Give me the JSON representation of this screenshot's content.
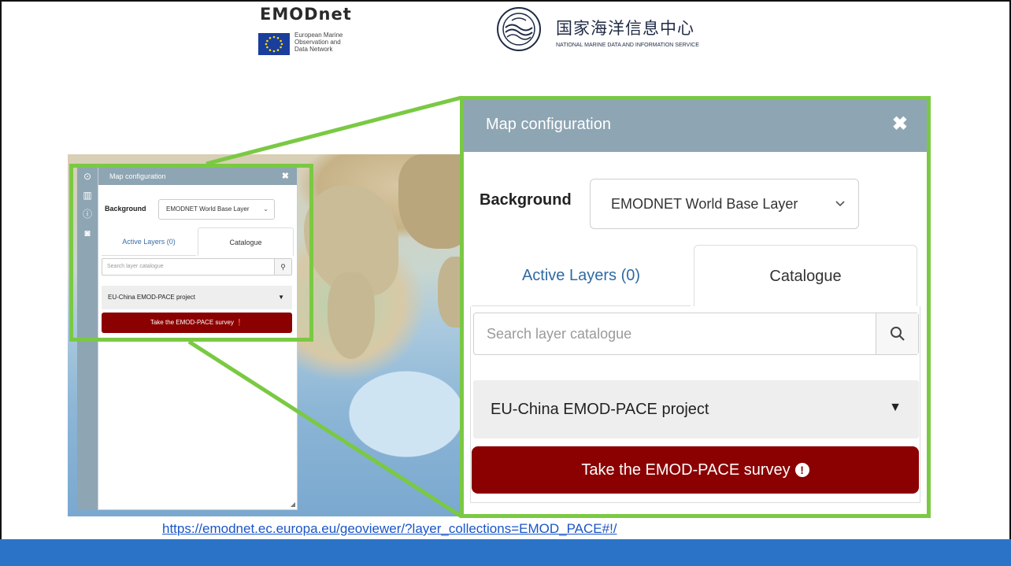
{
  "logos": {
    "emodnet_word": "EMODnet",
    "emodnet_subtitle": "European Marine\nObservation and\nData Network",
    "nmdis_cn": "国家海洋信息中心",
    "nmdis_en": "NATIONAL MARINE DATA AND INFORMATION SERVICE"
  },
  "sidebar_icons": [
    "target-icon",
    "map-icon",
    "info-icon",
    "camera-icon"
  ],
  "panel": {
    "title": "Map configuration",
    "close_glyph": "✖",
    "background_label": "Background",
    "background_value": "EMODNET World Base Layer",
    "caret": "⌄",
    "tab_active_layers": "Active Layers (0)",
    "tab_catalogue": "Catalogue",
    "search_placeholder": "Search layer catalogue",
    "project_label": "EU-China EMOD-PACE project",
    "project_caret": "▼",
    "survey_label": "Take the EMOD-PACE survey",
    "survey_icon": "!"
  },
  "footer": {
    "url": "https://emodnet.ec.europa.eu/geoviewer/?layer_collections=EMOD_PACE#!/"
  },
  "colors": {
    "highlight": "#7ac943",
    "panel_header": "#8ea5b3",
    "survey_button": "#8b0000",
    "footer_bar": "#2b73c6",
    "link": "#1a56c7"
  }
}
